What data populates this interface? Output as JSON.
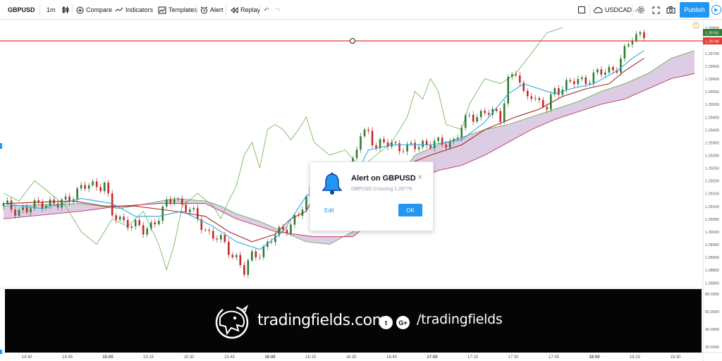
{
  "toolbar": {
    "symbol": "GBPUSD",
    "interval": "1m",
    "compare": "Compare",
    "indicators": "Indicators",
    "templates": "Templates",
    "alert": "Alert",
    "replay": "Replay",
    "currency": "USDCAD",
    "publish": "Publish"
  },
  "alert_dialog": {
    "title": "Alert on GBPUSD",
    "message": "GBPUSD Crossing 1.29776",
    "close": "×",
    "edit": "Edit",
    "ok": "OK"
  },
  "banner": {
    "site": "tradingfields.com",
    "twitter": "t",
    "gplus": "G+",
    "handle": "/tradingfields"
  },
  "colors": {
    "accent": "#2196f3",
    "up_candle": "#2e7d32",
    "down_candle": "#c62828",
    "alert_line": "#e53935",
    "cloud": "#d6c4e0",
    "tenkan": "#29a8e0",
    "kijun": "#a52a2a",
    "chikou": "#6ab04c",
    "banner_bg": "#050505"
  },
  "chart_data": {
    "type": "candlestick",
    "price_ticks": [
      "1.29800",
      "1.29750",
      "1.29700",
      "1.29650",
      "1.29600",
      "1.29550",
      "1.29500",
      "1.29450",
      "1.29400",
      "1.29350",
      "1.29300",
      "1.29250",
      "1.29200",
      "1.29150",
      "1.29100",
      "1.29050",
      "1.29000",
      "1.28950",
      "1.28900",
      "1.28850",
      "1.28800"
    ],
    "price_ylim": [
      1.2878,
      1.2982
    ],
    "last_price": "1.29781",
    "alert_price": "1.29748",
    "time_ticks": [
      "14:30",
      "14:45",
      "15:00",
      "15:15",
      "15:30",
      "15:45",
      "16:00",
      "16:15",
      "16:30",
      "16:45",
      "17:00",
      "17:15",
      "17:30",
      "17:45",
      "18:00",
      "18:15",
      "18:30"
    ],
    "bold_time_ticks": [
      "15:00",
      "16:00",
      "17:00",
      "18:00"
    ],
    "oscillator_ticks": [
      "80.0000",
      "60.0000",
      "40.0000",
      "20.0000"
    ],
    "oscillator_ylim": [
      15,
      85
    ],
    "close_path": [
      [
        0,
        1.291
      ],
      [
        6,
        1.2908
      ],
      [
        10,
        1.2912
      ],
      [
        14,
        1.291
      ],
      [
        18,
        1.2915
      ],
      [
        22,
        1.2918
      ],
      [
        26,
        1.2919
      ],
      [
        28,
        1.2906
      ],
      [
        32,
        1.2904
      ],
      [
        36,
        1.29
      ],
      [
        40,
        1.2906
      ],
      [
        44,
        1.2914
      ],
      [
        48,
        1.2908
      ],
      [
        52,
        1.2901
      ],
      [
        56,
        1.2896
      ],
      [
        60,
        1.289
      ],
      [
        62,
        1.2884
      ],
      [
        64,
        1.289
      ],
      [
        68,
        1.2895
      ],
      [
        72,
        1.2901
      ],
      [
        76,
        1.2906
      ],
      [
        78,
        1.2912
      ],
      [
        80,
        1.2922
      ],
      [
        82,
        1.292
      ],
      [
        86,
        1.291
      ],
      [
        88,
        1.2915
      ],
      [
        92,
        1.2938
      ],
      [
        94,
        1.294
      ],
      [
        96,
        1.2933
      ],
      [
        100,
        1.2935
      ],
      [
        104,
        1.2932
      ],
      [
        108,
        1.2935
      ],
      [
        112,
        1.2934
      ],
      [
        116,
        1.2936
      ],
      [
        120,
        1.2945
      ],
      [
        124,
        1.2947
      ],
      [
        128,
        1.2945
      ],
      [
        130,
        1.296
      ],
      [
        132,
        1.2962
      ],
      [
        134,
        1.2953
      ],
      [
        136,
        1.2955
      ],
      [
        138,
        1.295
      ],
      [
        140,
        1.2948
      ],
      [
        142,
        1.2956
      ],
      [
        146,
        1.2958
      ],
      [
        150,
        1.296
      ],
      [
        154,
        1.2962
      ],
      [
        158,
        1.2965
      ],
      [
        160,
        1.297
      ],
      [
        162,
        1.2976
      ],
      [
        164,
        1.29781
      ]
    ],
    "tenkan_path": [
      [
        0,
        1.2911
      ],
      [
        10,
        1.2909
      ],
      [
        20,
        1.2913
      ],
      [
        28,
        1.2911
      ],
      [
        34,
        1.2906
      ],
      [
        40,
        1.2906
      ],
      [
        46,
        1.2908
      ],
      [
        54,
        1.2902
      ],
      [
        60,
        1.2896
      ],
      [
        66,
        1.2893
      ],
      [
        72,
        1.29
      ],
      [
        78,
        1.2914
      ],
      [
        84,
        1.2918
      ],
      [
        90,
        1.292
      ],
      [
        94,
        1.2932
      ],
      [
        100,
        1.2934
      ],
      [
        110,
        1.2934
      ],
      [
        118,
        1.2936
      ],
      [
        124,
        1.2943
      ],
      [
        130,
        1.2954
      ],
      [
        134,
        1.2958
      ],
      [
        138,
        1.2956
      ],
      [
        142,
        1.2954
      ],
      [
        146,
        1.2956
      ],
      [
        152,
        1.2958
      ],
      [
        158,
        1.2963
      ],
      [
        162,
        1.2968
      ],
      [
        165,
        1.2971
      ]
    ],
    "kijun_path": [
      [
        0,
        1.2911
      ],
      [
        18,
        1.2912
      ],
      [
        26,
        1.291
      ],
      [
        34,
        1.291
      ],
      [
        44,
        1.2908
      ],
      [
        52,
        1.2906
      ],
      [
        58,
        1.29
      ],
      [
        64,
        1.2896
      ],
      [
        70,
        1.2899
      ],
      [
        74,
        1.2905
      ],
      [
        78,
        1.2908
      ],
      [
        80,
        1.2914
      ],
      [
        84,
        1.2914
      ],
      [
        92,
        1.2916
      ],
      [
        100,
        1.2924
      ],
      [
        110,
        1.293
      ],
      [
        118,
        1.2934
      ],
      [
        124,
        1.294
      ],
      [
        132,
        1.2945
      ],
      [
        138,
        1.2948
      ],
      [
        144,
        1.2953
      ],
      [
        150,
        1.2956
      ],
      [
        156,
        1.2958
      ],
      [
        160,
        1.2963
      ],
      [
        164,
        1.2967
      ],
      [
        165,
        1.2968
      ]
    ],
    "chikou_path": [
      [
        0,
        1.2915
      ],
      [
        4,
        1.2912
      ],
      [
        8,
        1.292
      ],
      [
        12,
        1.2915
      ],
      [
        16,
        1.291
      ],
      [
        20,
        1.29
      ],
      [
        24,
        1.2895
      ],
      [
        28,
        1.2905
      ],
      [
        32,
        1.2902
      ],
      [
        36,
        1.2908
      ],
      [
        40,
        1.2895
      ],
      [
        42,
        1.2885
      ],
      [
        44,
        1.2895
      ],
      [
        46,
        1.291
      ],
      [
        50,
        1.2915
      ],
      [
        54,
        1.291
      ],
      [
        56,
        1.2905
      ],
      [
        58,
        1.2912
      ],
      [
        60,
        1.2918
      ],
      [
        62,
        1.293
      ],
      [
        64,
        1.2935
      ],
      [
        66,
        1.2925
      ],
      [
        68,
        1.294
      ],
      [
        70,
        1.2942
      ],
      [
        72,
        1.294
      ],
      [
        74,
        1.2936
      ],
      [
        76,
        1.294
      ],
      [
        78,
        1.2945
      ],
      [
        80,
        1.2935
      ],
      [
        84,
        1.293
      ],
      [
        88,
        1.2932
      ],
      [
        92,
        1.2925
      ],
      [
        96,
        1.293
      ],
      [
        100,
        1.2935
      ],
      [
        104,
        1.2945
      ],
      [
        106,
        1.2955
      ],
      [
        108,
        1.2952
      ],
      [
        110,
        1.296
      ],
      [
        112,
        1.2955
      ],
      [
        114,
        1.2942
      ],
      [
        118,
        1.294
      ],
      [
        120,
        1.295
      ],
      [
        124,
        1.296
      ],
      [
        128,
        1.2958
      ],
      [
        132,
        1.2962
      ],
      [
        136,
        1.297
      ],
      [
        140,
        1.2978
      ],
      [
        144,
        1.298
      ]
    ],
    "span_a_path": [
      [
        0,
        1.291
      ],
      [
        20,
        1.2911
      ],
      [
        30,
        1.2909
      ],
      [
        44,
        1.2913
      ],
      [
        52,
        1.2912
      ],
      [
        56,
        1.291
      ],
      [
        60,
        1.2907
      ],
      [
        66,
        1.2904
      ],
      [
        72,
        1.29
      ],
      [
        78,
        1.2896
      ],
      [
        84,
        1.2895
      ],
      [
        90,
        1.29
      ],
      [
        96,
        1.291
      ],
      [
        100,
        1.2918
      ],
      [
        106,
        1.293
      ],
      [
        112,
        1.2934
      ],
      [
        118,
        1.2937
      ],
      [
        124,
        1.294
      ],
      [
        130,
        1.2942
      ],
      [
        136,
        1.2945
      ],
      [
        142,
        1.2948
      ],
      [
        148,
        1.2951
      ],
      [
        154,
        1.2955
      ],
      [
        160,
        1.2958
      ],
      [
        166,
        1.2962
      ],
      [
        172,
        1.2968
      ],
      [
        178,
        1.2971
      ]
    ],
    "span_b_path": [
      [
        0,
        1.2905
      ],
      [
        20,
        1.2908
      ],
      [
        30,
        1.291
      ],
      [
        40,
        1.2911
      ],
      [
        52,
        1.2911
      ],
      [
        60,
        1.2905
      ],
      [
        70,
        1.29
      ],
      [
        80,
        1.2898
      ],
      [
        90,
        1.2898
      ],
      [
        100,
        1.291
      ],
      [
        106,
        1.292
      ],
      [
        112,
        1.2924
      ],
      [
        118,
        1.2926
      ],
      [
        124,
        1.293
      ],
      [
        130,
        1.2935
      ],
      [
        136,
        1.294
      ],
      [
        142,
        1.2944
      ],
      [
        148,
        1.2947
      ],
      [
        154,
        1.295
      ],
      [
        160,
        1.2952
      ],
      [
        166,
        1.2956
      ],
      [
        172,
        1.296
      ],
      [
        178,
        1.2962
      ]
    ]
  }
}
